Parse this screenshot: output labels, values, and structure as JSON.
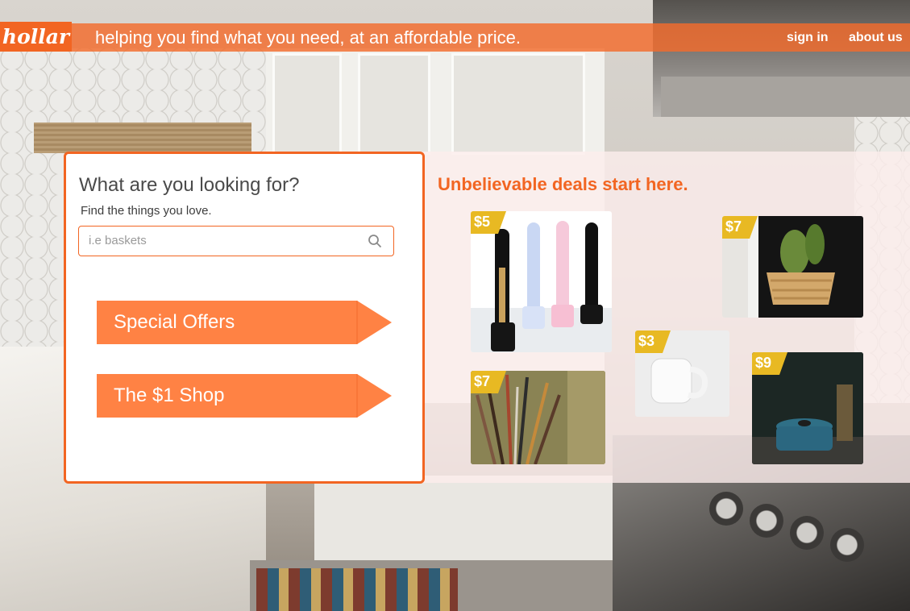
{
  "header": {
    "logo_text": "hollar",
    "tagline": "helping you find what you need, at an affordable price.",
    "nav": [
      {
        "label": "sign in"
      },
      {
        "label": "about us"
      }
    ]
  },
  "search_card": {
    "heading": "What are you looking for?",
    "subheading": "Find the things you love.",
    "search_placeholder": "i.e baskets",
    "search_icon": "search-icon",
    "buttons": [
      {
        "label": "Special Offers"
      },
      {
        "label": "The $1 Shop"
      }
    ]
  },
  "deals": {
    "title": "Unbelievable deals start here.",
    "products": [
      {
        "name": "electric-toothbrushes",
        "price": "$5"
      },
      {
        "name": "basket-plant",
        "price": "$7"
      },
      {
        "name": "paint-brushes",
        "price": "$7"
      },
      {
        "name": "white-mug",
        "price": "$3"
      },
      {
        "name": "dutch-oven",
        "price": "$9"
      }
    ]
  },
  "colors": {
    "brand_orange": "#f26522",
    "button_orange": "#ff8244",
    "price_tag_yellow": "#e8b923"
  }
}
